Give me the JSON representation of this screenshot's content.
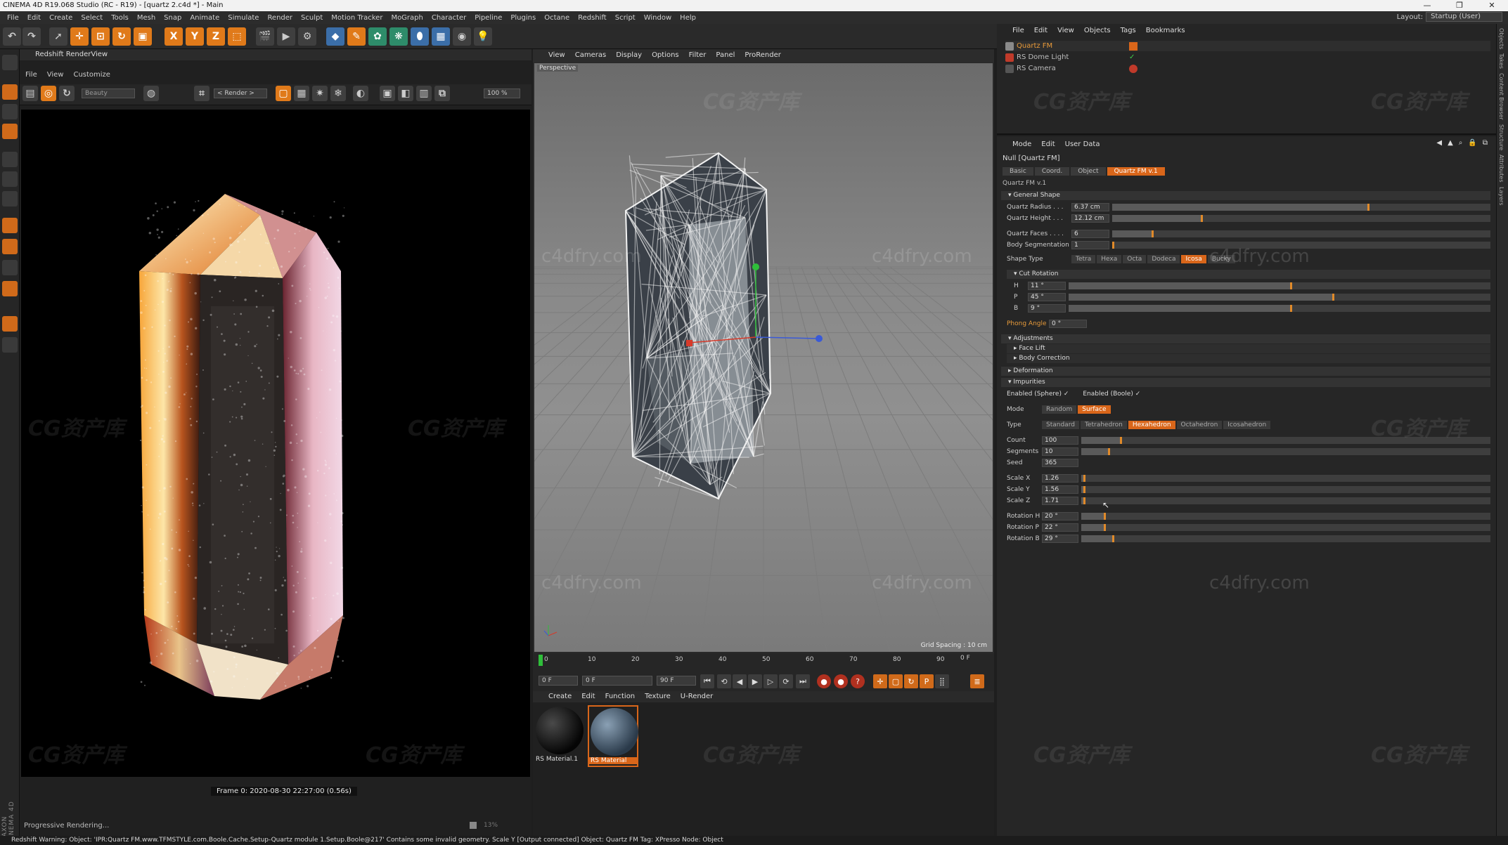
{
  "window": {
    "title": "CINEMA 4D R19.068 Studio (RC - R19) - [quartz 2.c4d *] - Main",
    "minimize": "—",
    "maximize": "❐",
    "close": "✕"
  },
  "menubar": [
    "File",
    "Edit",
    "Create",
    "Select",
    "Tools",
    "Mesh",
    "Snap",
    "Animate",
    "Simulate",
    "Render",
    "Sculpt",
    "Motion Tracker",
    "MoGraph",
    "Character",
    "Pipeline",
    "Plugins",
    "Octane",
    "Redshift",
    "Script",
    "Window",
    "Help"
  ],
  "layout": {
    "label": "Layout:",
    "value": "Startup (User)"
  },
  "toolbar": {
    "x": "X",
    "y": "Y",
    "z": "Z"
  },
  "renderview": {
    "title": "Redshift RenderView",
    "menu": [
      "File",
      "View",
      "Customize"
    ],
    "aov": "Beauty",
    "camera": "< Render >",
    "zoom": "100 %",
    "frame_info": "Frame  0:  2020-08-30  22:27:00  (0.56s)",
    "progress": "Progressive Rendering...",
    "progress_pct": "13%"
  },
  "viewport": {
    "menu": [
      "View",
      "Cameras",
      "Display",
      "Options",
      "Filter",
      "Panel",
      "ProRender"
    ],
    "label": "Perspective",
    "grid_spacing": "Grid Spacing : 10 cm"
  },
  "timeline": {
    "ticks": [
      "0",
      "10",
      "20",
      "30",
      "40",
      "50",
      "60",
      "70",
      "80",
      "90"
    ],
    "end_label": "0 F",
    "start_field": "0 F",
    "min_field": "0 F",
    "max_field": "90 F",
    "end_field": "90 F"
  },
  "materials": {
    "menu": [
      "Create",
      "Edit",
      "Function",
      "Texture",
      "U-Render"
    ],
    "items": [
      "RS Material.1",
      "RS Material"
    ]
  },
  "object_manager": {
    "menu": [
      "File",
      "Edit",
      "View",
      "Objects",
      "Tags",
      "Bookmarks"
    ],
    "objects": [
      "Quartz FM",
      "RS Dome Light",
      "RS Camera"
    ]
  },
  "attributes": {
    "menu": [
      "Mode",
      "Edit",
      "User Data"
    ],
    "object": "Null [Quartz FM]",
    "tabs": [
      "Basic",
      "Coord.",
      "Object",
      "Quartz FM v.1"
    ],
    "version": "Quartz FM v.1",
    "sections": {
      "general": "General Shape",
      "cut_rotation": "Cut Rotation",
      "adjustments": "Adjustments",
      "face_lift": "Face Lift",
      "body_correction": "Body Correction",
      "deformation": "Deformation",
      "impurities": "Impurities"
    },
    "params": {
      "quartz_radius": {
        "label": "Quartz Radius . . .",
        "value": "6.37 cm",
        "fill": 0.68
      },
      "quartz_height": {
        "label": "Quartz Height . . .",
        "value": "12.12 cm",
        "fill": 0.24
      },
      "quartz_faces": {
        "label": "Quartz Faces . . . .",
        "value": "6",
        "fill": 0.11
      },
      "body_segmentation": {
        "label": "Body Segmentation",
        "value": "1",
        "fill": 0.0
      },
      "cut_h": {
        "label": "H",
        "value": "11 °",
        "fill": 0.53
      },
      "cut_p": {
        "label": "P",
        "value": "45 °",
        "fill": 0.63
      },
      "cut_b": {
        "label": "B",
        "value": "9 °",
        "fill": 0.53
      },
      "phong_angle": {
        "label": "Phong Angle",
        "value": "0 °"
      },
      "count": {
        "label": "Count",
        "value": "100",
        "fill": 0.1
      },
      "segments": {
        "label": "Segments",
        "value": "10",
        "fill": 0.07
      },
      "seed": {
        "label": "Seed",
        "value": "365"
      },
      "scale_x": {
        "label": "Scale X",
        "value": "1.26",
        "fill": 0.01
      },
      "scale_y": {
        "label": "Scale Y",
        "value": "1.56",
        "fill": 0.01
      },
      "scale_z": {
        "label": "Scale Z",
        "value": "1.71",
        "fill": 0.01
      },
      "rot_h": {
        "label": "Rotation H",
        "value": "20 °",
        "fill": 0.06
      },
      "rot_p": {
        "label": "Rotation P",
        "value": "22 °",
        "fill": 0.06
      },
      "rot_b": {
        "label": "Rotation B",
        "value": "29 °",
        "fill": 0.08
      }
    },
    "shape_type": {
      "label": "Shape Type",
      "options": [
        "Tetra",
        "Hexa",
        "Octa",
        "Dodeca",
        "Icosa",
        "Bucky"
      ],
      "selected": "Icosa"
    },
    "enabled_sphere": "Enabled (Sphere) ✓",
    "enabled_boole": "Enabled (Boole) ✓",
    "mode": {
      "label": "Mode",
      "options": [
        "Random",
        "Surface"
      ],
      "selected": "Surface"
    },
    "type": {
      "label": "Type",
      "options": [
        "Standard",
        "Tetrahedron",
        "Hexahedron",
        "Octahedron",
        "Icosahedron"
      ],
      "selected": "Hexahedron"
    }
  },
  "right_strip": [
    "Objects",
    "Takes",
    "Content Browser",
    "Structure",
    "Attributes",
    "Layers"
  ],
  "status": "Redshift Warning: Object: 'IPR:Quartz FM.www.TFMSTYLE.com.Boole.Cache.Setup-Quartz module 1.Setup.Boole@217' Contains some invalid geometry.     Scale Y [Output connected] Object: Quartz FM Tag: XPresso Node: Object",
  "watermarks": {
    "logo": "CG资产库",
    "site": "c4dfry.com"
  }
}
